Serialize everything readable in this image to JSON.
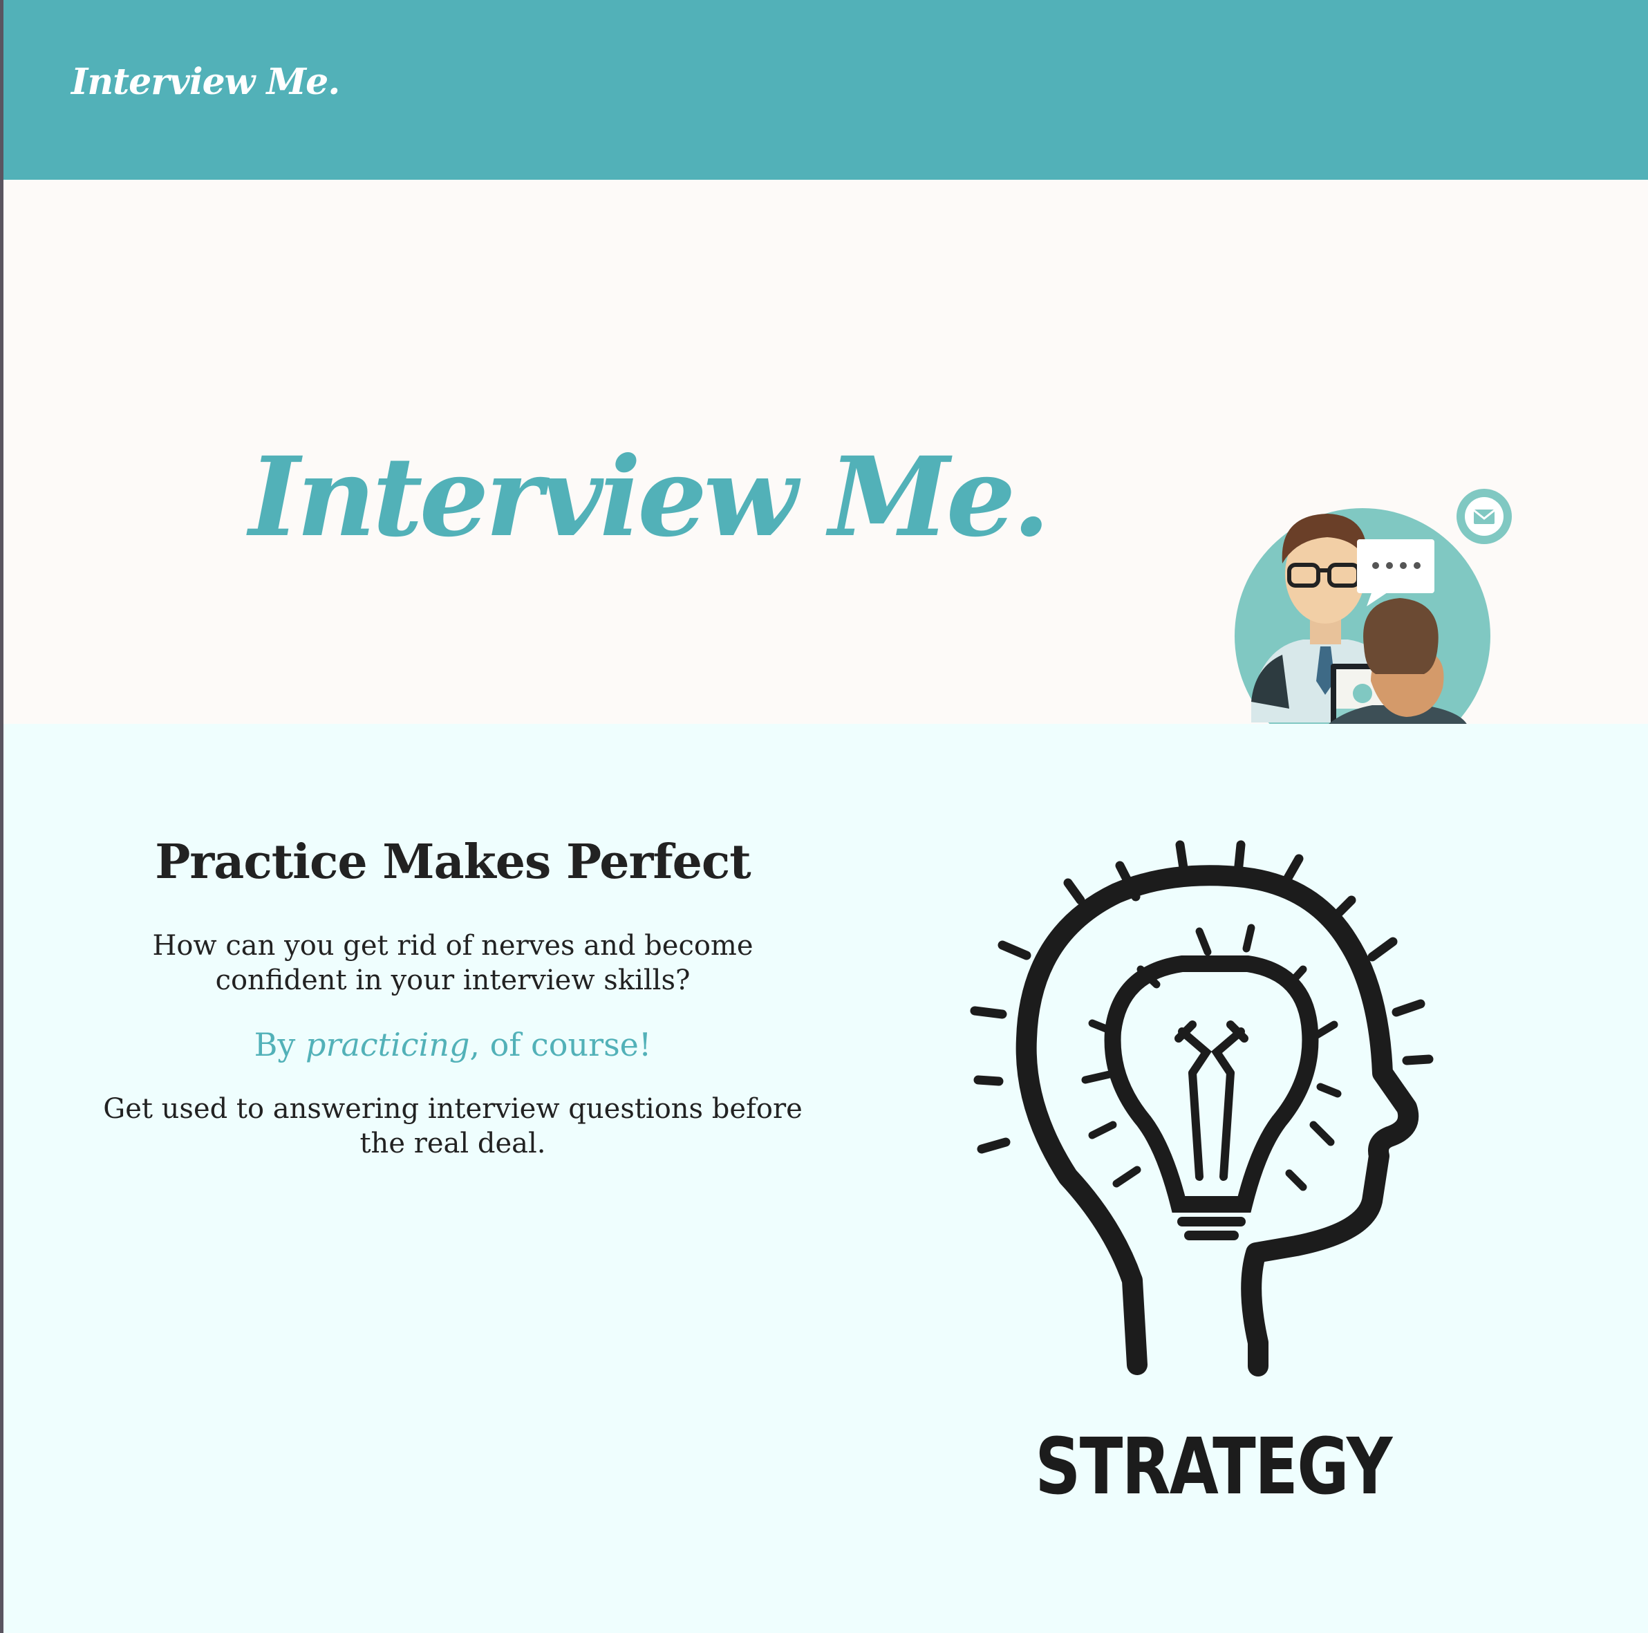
{
  "navbar": {
    "brand": "Interview Me."
  },
  "hero": {
    "title": "Interview Me.",
    "illustration_icons": [
      "mail-icon",
      "phone-icon",
      "speech-bubble-icon",
      "laptop-icon"
    ]
  },
  "section": {
    "heading": "Practice Makes Perfect",
    "paragraph1": "How can you get rid of nerves and become confident in your interview skills?",
    "accent_prefix": "By ",
    "accent_emphasis": "practicing",
    "accent_suffix": ", of course!",
    "paragraph2": "Get used to answering interview questions before the real deal.",
    "graphic_label": "STRATEGY"
  },
  "colors": {
    "accent": "#52b1b8",
    "navbar_bg": "#52b1b8",
    "hero_bg": "#fdfaf8",
    "section_bg": "#effefe",
    "text": "#222222"
  }
}
